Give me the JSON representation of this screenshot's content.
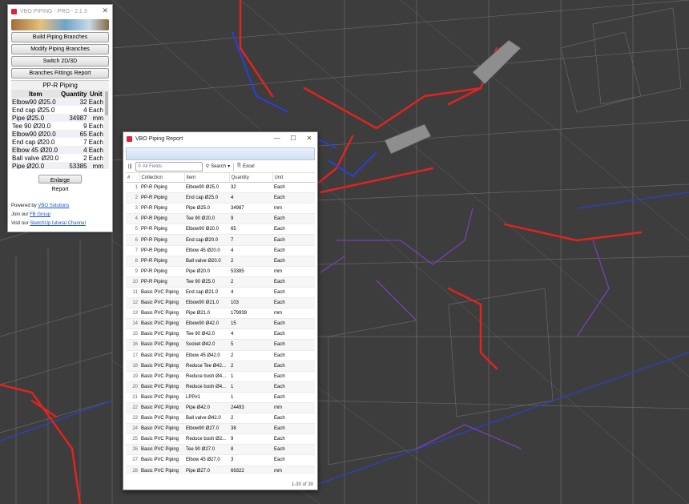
{
  "plugin": {
    "title": "VBO PIPING - PRO - 2.1.3",
    "buttons": [
      "Build Piping Branches",
      "Modify Piping Branches",
      "Switch 2D/3D",
      "Branches Fittings Report"
    ],
    "table_title": "PP-R Piping",
    "columns": [
      "Item",
      "Quantity",
      "Unit"
    ],
    "rows": [
      {
        "item": "Elbow90 Ø25.0",
        "qty": "32",
        "unit": "Each"
      },
      {
        "item": "End cap Ø25.0",
        "qty": "4",
        "unit": "Each"
      },
      {
        "item": "Pipe Ø25.0",
        "qty": "34987",
        "unit": "mm"
      },
      {
        "item": "Tee 90 Ø20.0",
        "qty": "9",
        "unit": "Each"
      },
      {
        "item": "Elbow90 Ø20.0",
        "qty": "65",
        "unit": "Each"
      },
      {
        "item": "End cap Ø20.0",
        "qty": "7",
        "unit": "Each"
      },
      {
        "item": "Elbow 45 Ø20.0",
        "qty": "4",
        "unit": "Each"
      },
      {
        "item": "Ball valve Ø20.0",
        "qty": "2",
        "unit": "Each"
      },
      {
        "item": "Pipe Ø20.0",
        "qty": "53385",
        "unit": "mm"
      }
    ],
    "enlarge_label": "Enlarge Report",
    "footer": {
      "powered_prefix": "Powered by ",
      "powered_link": "VBO Solutions",
      "join_prefix": "Join our ",
      "join_link": "FB Group",
      "visit_prefix": "Visit our ",
      "visit_link": "SketchUp tutorial Channel"
    }
  },
  "report": {
    "title": "VBO Piping Report",
    "search_placeholder": "All Fields",
    "search_label": "Search",
    "excel_label": "Excel",
    "columns": [
      "#",
      "Collection",
      "Item",
      "Quantity",
      "Unit"
    ],
    "rows": [
      [
        "1",
        "PP-R Piping",
        "Elbow90 Ø25.0",
        "32",
        "Each"
      ],
      [
        "2",
        "PP-R Piping",
        "End cap Ø25.0",
        "4",
        "Each"
      ],
      [
        "3",
        "PP-R Piping",
        "Pipe Ø25.0",
        "34987",
        "mm"
      ],
      [
        "4",
        "PP-R Piping",
        "Tee 90 Ø20.0",
        "9",
        "Each"
      ],
      [
        "5",
        "PP-R Piping",
        "Elbow90 Ø20.0",
        "65",
        "Each"
      ],
      [
        "6",
        "PP-R Piping",
        "End cap Ø20.0",
        "7",
        "Each"
      ],
      [
        "7",
        "PP-R Piping",
        "Elbow 45 Ø20.0",
        "4",
        "Each"
      ],
      [
        "8",
        "PP-R Piping",
        "Ball valve Ø20.0",
        "2",
        "Each"
      ],
      [
        "9",
        "PP-R Piping",
        "Pipe Ø20.0",
        "53385",
        "mm"
      ],
      [
        "10",
        "PP-R Piping",
        "Tee 90 Ø25.0",
        "2",
        "Each"
      ],
      [
        "11",
        "Basic PVC Piping",
        "End cap Ø21.0",
        "4",
        "Each"
      ],
      [
        "12",
        "Basic PVC Piping",
        "Elbow90 Ø21.0",
        "103",
        "Each"
      ],
      [
        "13",
        "Basic PVC Piping",
        "Pipe Ø21.0",
        "179939",
        "mm"
      ],
      [
        "14",
        "Basic PVC Piping",
        "Elbow90 Ø42.0",
        "15",
        "Each"
      ],
      [
        "15",
        "Basic PVC Piping",
        "Tee 90 Ø42.0",
        "4",
        "Each"
      ],
      [
        "16",
        "Basic PVC Piping",
        "Socket Ø42.0",
        "5",
        "Each"
      ],
      [
        "17",
        "Basic PVC Piping",
        "Elbow 45 Ø42.0",
        "2",
        "Each"
      ],
      [
        "18",
        "Basic PVC Piping",
        "Reduce Tee Ø42...",
        "2",
        "Each"
      ],
      [
        "19",
        "Basic PVC Piping",
        "Reduce bush Ø4...",
        "1",
        "Each"
      ],
      [
        "20",
        "Basic PVC Piping",
        "Reduce bush Ø4...",
        "1",
        "Each"
      ],
      [
        "21",
        "Basic PVC Piping",
        "LPP#1",
        "1",
        "Each"
      ],
      [
        "22",
        "Basic PVC Piping",
        "Pipe Ø42.0",
        "24493",
        "mm"
      ],
      [
        "23",
        "Basic PVC Piping",
        "Ball valve Ø42.0",
        "2",
        "Each"
      ],
      [
        "24",
        "Basic PVC Piping",
        "Elbow90 Ø27.0",
        "38",
        "Each"
      ],
      [
        "25",
        "Basic PVC Piping",
        "Reduce bush Ø2...",
        "9",
        "Each"
      ],
      [
        "26",
        "Basic PVC Piping",
        "Tee 90 Ø27.0",
        "8",
        "Each"
      ],
      [
        "27",
        "Basic PVC Piping",
        "Elbow 45 Ø27.0",
        "3",
        "Each"
      ],
      [
        "28",
        "Basic PVC Piping",
        "Pipe Ø27.0",
        "69322",
        "mm"
      ],
      [
        "29",
        "Basic PVC Piping",
        "Tee 90 Ø21.0",
        "22",
        "Each"
      ],
      [
        "30",
        "Basic PVC Piping",
        "Elbow 45 Ø21.0",
        "3",
        "Each"
      ]
    ],
    "status": "1-30 of 30"
  },
  "colors": {
    "viewport_bg": "#3a3a3a",
    "pipe_red": "#e0241f",
    "pipe_blue": "#2a3fd6",
    "pipe_purple": "#7a3fb5",
    "link": "#1a55c0"
  }
}
